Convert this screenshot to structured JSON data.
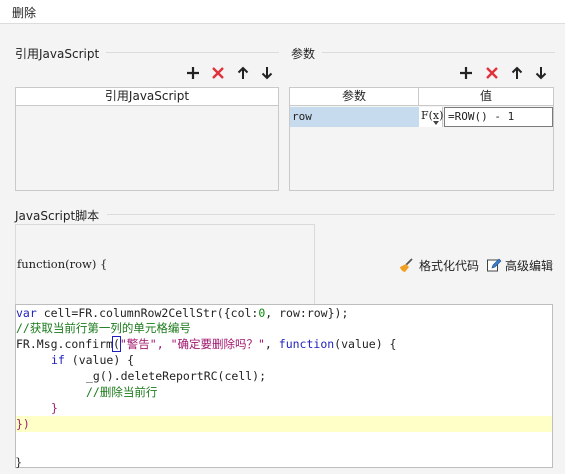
{
  "window": {
    "title": "删除"
  },
  "ref_js": {
    "group_title": "引用JavaScript",
    "column_header": "引用JavaScript"
  },
  "params": {
    "group_title": "参数",
    "headers": {
      "name": "参数",
      "value": "值"
    },
    "rows": [
      {
        "name": "row",
        "formula_label": "F(x)",
        "value": "=ROW() - 1"
      }
    ]
  },
  "toolbar_icons": {
    "add": "plus-icon",
    "remove": "cross-icon",
    "up": "arrow-up-icon",
    "down": "arrow-down-icon"
  },
  "script": {
    "group_title": "JavaScript脚本",
    "signature": "function(row) {",
    "format_label": "格式化代码",
    "advanced_label": "高级编辑",
    "closing_brace": "}",
    "code": {
      "l1": {
        "a": "var",
        "b": " cell=FR.columnRow2CellStr({col:",
        "c": "0",
        "d": ", row:row});"
      },
      "l2": "//获取当前行第一列的单元格编号",
      "l3": {
        "a": "FR.Msg.confirm",
        "b": "(",
        "c": "\"警告\", \"确定要删除吗？\"",
        "d": ", ",
        "e": "function",
        "f": "(value) {"
      },
      "l4": {
        "a": "if",
        "b": " (value) {"
      },
      "l5": "_g().deleteReportRC(cell);",
      "l6": "//删除当前行",
      "l7": "}",
      "l8": "})"
    }
  },
  "colors": {
    "accent_red": "#e0323a",
    "keyword": "#1e1ebe",
    "string": "#a0146e",
    "comment": "#1a7a1a",
    "highlight_line": "#ffffc8",
    "selected_cell": "#c6dcee"
  }
}
